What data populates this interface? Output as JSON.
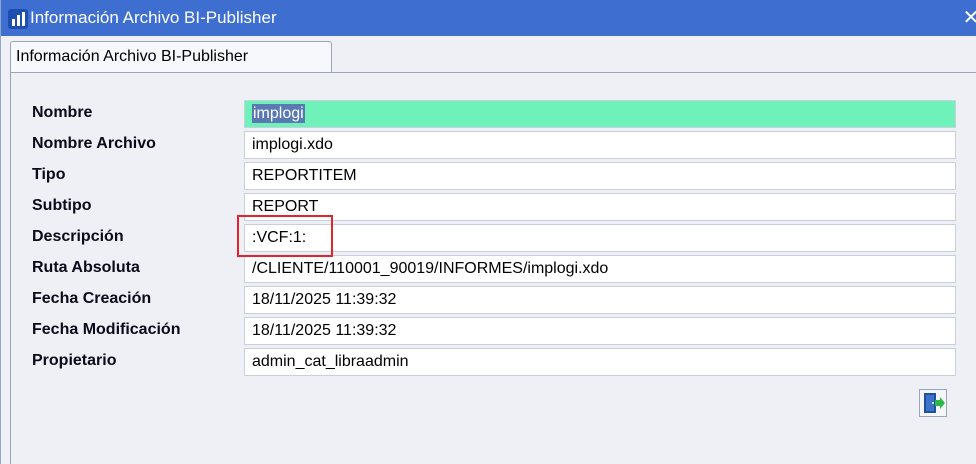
{
  "window": {
    "title": "Información Archivo BI-Publisher",
    "app_icon": "bars-logo-icon",
    "close_glyph": "✕"
  },
  "tab": {
    "label": "Información Archivo BI-Publisher"
  },
  "fields": [
    {
      "label": "Nombre",
      "value": "implogi"
    },
    {
      "label": "Nombre Archivo",
      "value": "implogi.xdo"
    },
    {
      "label": "Tipo",
      "value": "REPORTITEM"
    },
    {
      "label": "Subtipo",
      "value": "REPORT"
    },
    {
      "label": "Descripción",
      "value": ":VCF:1:"
    },
    {
      "label": "Ruta Absoluta",
      "value": "/CLIENTE/110001_90019/INFORMES/implogi.xdo"
    },
    {
      "label": "Fecha Creación",
      "value": "18/11/2025 11:39:32"
    },
    {
      "label": "Fecha Modificación",
      "value": "18/11/2025 11:39:32"
    },
    {
      "label": "Propietario",
      "value": "admin_cat_libraadmin"
    }
  ],
  "colors": {
    "titlebar": "#3e6fd0",
    "active_field": "#6ef2b9",
    "selection": "#5a79b3",
    "highlight_box": "#e0262c"
  },
  "exit_button": {
    "icon": "exit-door-icon"
  }
}
